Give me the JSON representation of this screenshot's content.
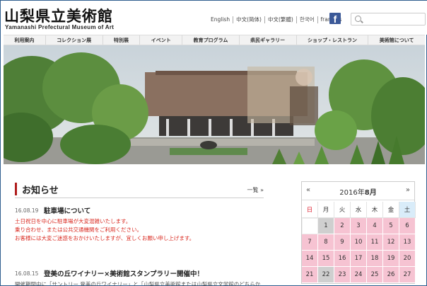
{
  "header": {
    "logo_jp": "山梨県立美術館",
    "logo_en": "Yamanashi Prefectural Museum of Art",
    "languages": [
      "English",
      "中文(简体)",
      "中文(繁體)",
      "한국어",
      "français"
    ],
    "facebook_label": "f",
    "search_placeholder": ""
  },
  "nav": {
    "items": [
      "利用案内",
      "コレクション展",
      "特別展",
      "イベント",
      "教育プログラム",
      "県民ギャラリー",
      "ショップ・レストラン",
      "美術館について"
    ]
  },
  "news": {
    "title": "お知らせ",
    "more_label": "一覧",
    "more_icon": "double-chevron-right-icon",
    "items": [
      {
        "date": "16.08.19",
        "title": "駐車場について",
        "body": [
          "土日祝日を中心に駐車場が大変混雑いたします。",
          "乗り合わせ、または公共交通機関をご利用ください。",
          "お客様には大変ご迷惑をおかけいたしますが、宜しくお願い申し上げます。"
        ]
      },
      {
        "date": "16.08.15",
        "title": "登美の丘ワイナリー×美術館スタンプラリー開催中！",
        "body": [
          "開催期間中に「サントリー 登美の丘ワイナリー」と「山梨県立美術館または山梨県立文学館のどちらか"
        ]
      }
    ]
  },
  "calendar": {
    "year_label": "2016年",
    "month_label": "8月",
    "prev_label": "«",
    "next_label": "»",
    "weekdays": [
      "日",
      "月",
      "火",
      "水",
      "木",
      "金",
      "土"
    ],
    "weeks": [
      [
        "",
        "1",
        "2",
        "3",
        "4",
        "5",
        "6"
      ],
      [
        "7",
        "8",
        "9",
        "10",
        "11",
        "12",
        "13"
      ],
      [
        "14",
        "15",
        "16",
        "17",
        "18",
        "19",
        "20"
      ],
      [
        "21",
        "22",
        "23",
        "24",
        "25",
        "26",
        "27"
      ]
    ],
    "closed_days": [
      "1",
      "22"
    ],
    "open_color": "#f6c3d2",
    "closed_color": "#cfcfcf",
    "saturday_color": "#d9ecf9"
  },
  "colors": {
    "accent_red": "#b01e1e",
    "notice_red": "#d9281f",
    "facebook_blue": "#3b5998"
  }
}
